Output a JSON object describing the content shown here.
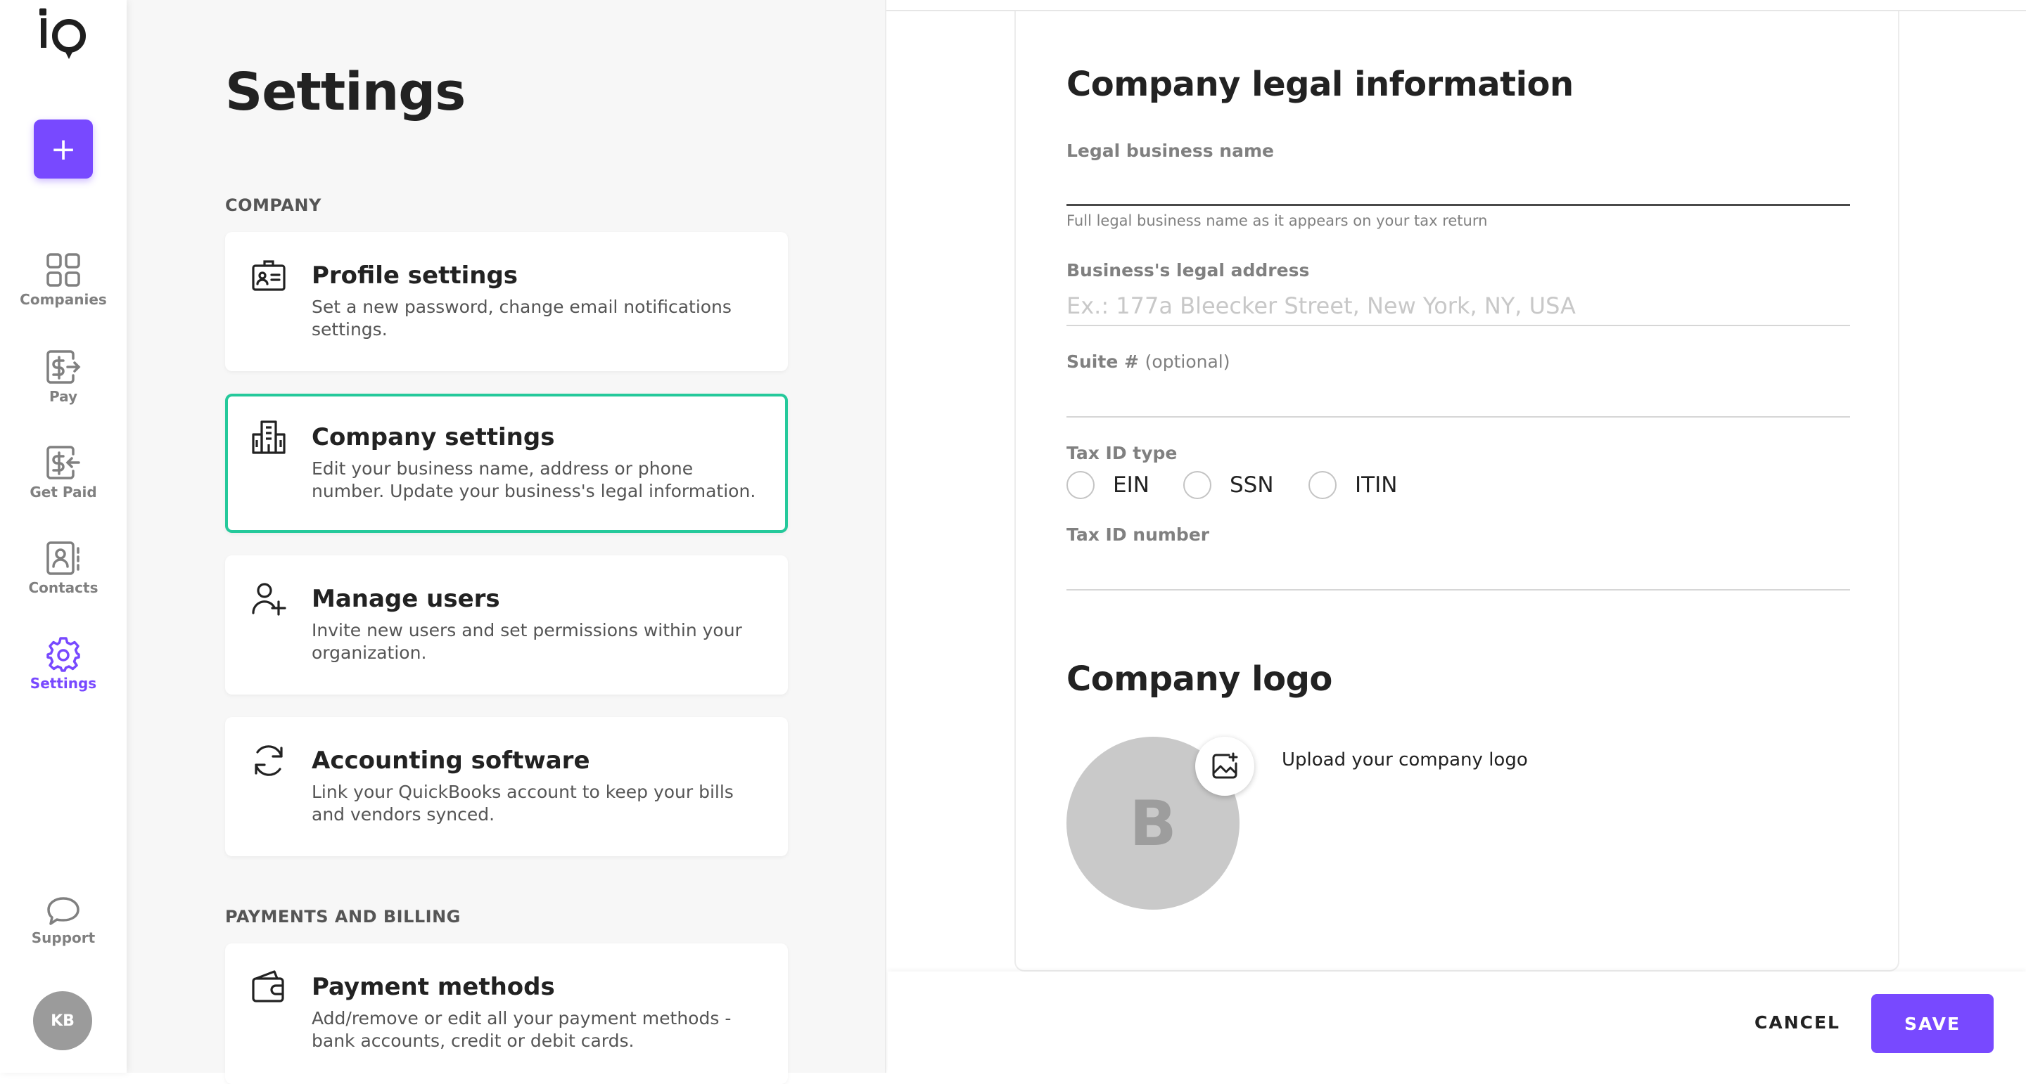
{
  "brand": {
    "logo": "io",
    "accent": "#7849ff",
    "active_border": "#25c99b"
  },
  "nav": {
    "new_label": "+",
    "items": [
      {
        "label": "Companies",
        "icon": "grid-icon"
      },
      {
        "label": "Pay",
        "icon": "dollar-send-icon"
      },
      {
        "label": "Get Paid",
        "icon": "dollar-receive-icon"
      },
      {
        "label": "Contacts",
        "icon": "contact-book-icon"
      },
      {
        "label": "Settings",
        "icon": "gear-icon",
        "active": true
      }
    ],
    "support_label": "Support",
    "avatar_initials": "KB"
  },
  "settings": {
    "title": "Settings",
    "company_section": "COMPANY",
    "cards": [
      {
        "title": "Profile settings",
        "desc": "Set a new password, change email notifications settings.",
        "icon": "id-card-icon"
      },
      {
        "title": "Company settings",
        "desc": "Edit your business name, address or phone number. Update your business's legal information.",
        "icon": "building-icon",
        "active": true
      },
      {
        "title": "Manage users",
        "desc": "Invite new users and set permissions within your organization.",
        "icon": "add-user-icon"
      },
      {
        "title": "Accounting software",
        "desc": "Link your QuickBooks account to keep your bills and vendors synced.",
        "icon": "sync-icon"
      }
    ],
    "payments_section": "PAYMENTS AND BILLING",
    "payment_card": {
      "title": "Payment methods",
      "desc": "Add/remove or edit all your payment methods - bank accounts, credit or debit cards.",
      "icon": "wallet-icon"
    }
  },
  "form": {
    "title": "Company legal information",
    "legal_name": {
      "label": "Legal business name",
      "value": "",
      "helper": "Full legal business name as it appears on your tax return"
    },
    "address": {
      "label": "Business's legal address",
      "placeholder": "Ex.: 177a Bleecker Street, New York, NY, USA",
      "value": ""
    },
    "suite": {
      "label": "Suite #",
      "optional": "(optional)",
      "value": ""
    },
    "tax_id_type": {
      "label": "Tax ID type",
      "options": [
        "EIN",
        "SSN",
        "ITIN"
      ]
    },
    "tax_id_number": {
      "label": "Tax ID number",
      "value": ""
    },
    "logo_section": {
      "title": "Company logo",
      "placeholder_initial": "B",
      "upload_text": "Upload your company logo"
    }
  },
  "footer": {
    "cancel_label": "CANCEL",
    "save_label": "SAVE"
  }
}
